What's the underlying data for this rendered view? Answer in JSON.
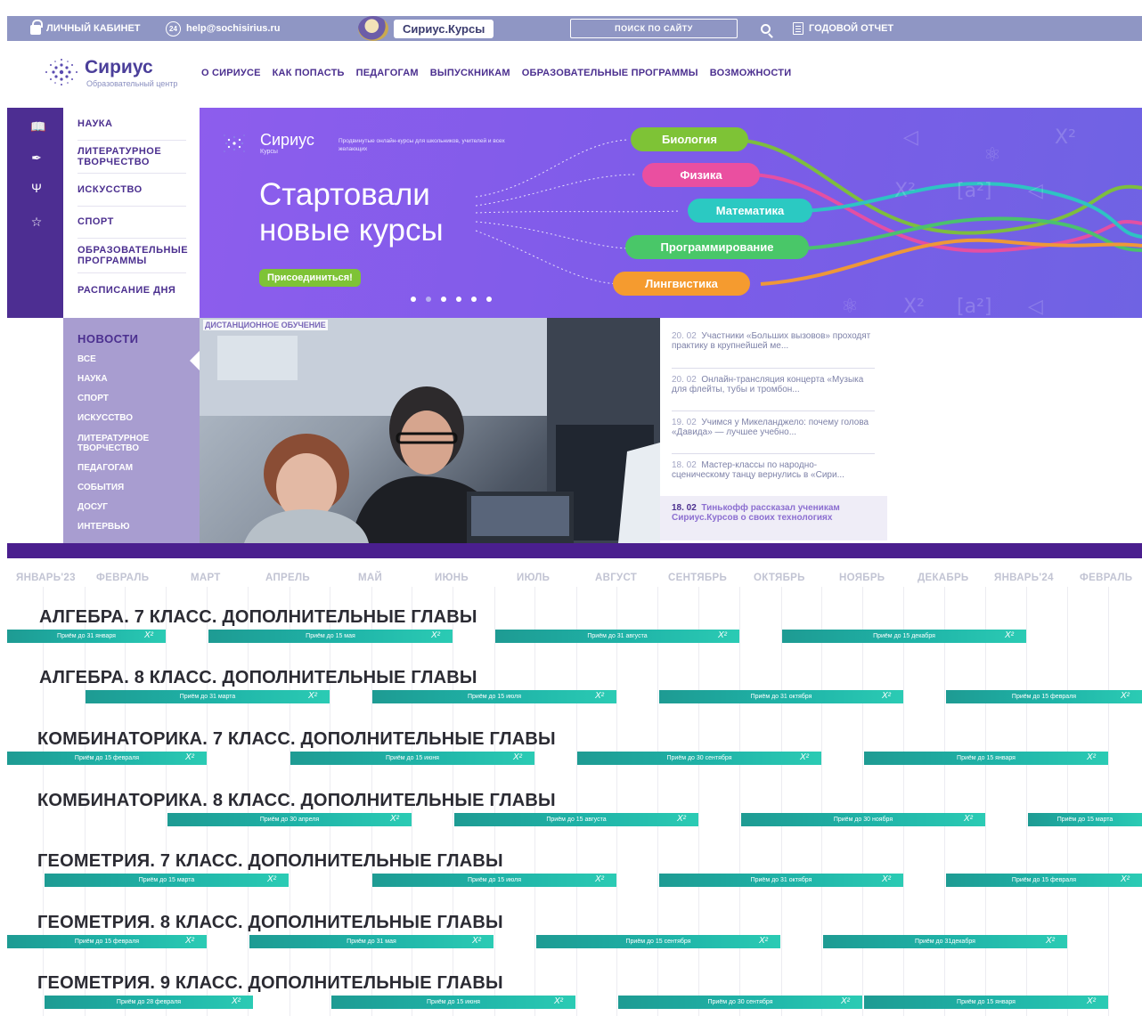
{
  "topbar": {
    "cabinet": "ЛИЧНЫЙ КАБИНЕТ",
    "email_icon_text": "24",
    "email": "help@sochisirius.ru",
    "kursy": "Сириус.Курсы",
    "search_placeholder": "ПОИСК ПО САЙТУ",
    "report": "ГОДОВОЙ ОТЧЕТ"
  },
  "header": {
    "logo_title": "Сириус",
    "logo_subtitle": "Образовательный центр",
    "nav": [
      "О СИРИУСЕ",
      "КАК ПОПАСТЬ",
      "ПЕДАГОГАМ",
      "ВЫПУСКНИКАМ",
      "ОБРАЗОВАТЕЛЬНЫЕ ПРОГРАММЫ",
      "ВОЗМОЖНОСТИ"
    ]
  },
  "leftmenu": {
    "items": [
      "НАУКА",
      "ЛИТЕРАТУРНОЕ ТВОРЧЕСТВО",
      "ИСКУССТВО",
      "СПОРТ",
      "ОБРАЗОВАТЕЛЬНЫЕ ПРОГРАММЫ",
      "РАСПИСАНИЕ ДНЯ"
    ],
    "icons": [
      "book-icon",
      "quill-icon",
      "lyre-icon",
      "trophy-icon"
    ]
  },
  "banner": {
    "logo_title": "Сириус",
    "logo_subtitle": "Курсы",
    "description": "Продвинутые онлайн-курсы для школьников, учителей и всех желающих",
    "headline": "Стартовали новые курсы",
    "join_button": "Присоединиться!",
    "subjects": [
      {
        "label": "Биология",
        "color": "#7ec336"
      },
      {
        "label": "Физика",
        "color": "#ea4fa0"
      },
      {
        "label": "Математика",
        "color": "#2bc9c2"
      },
      {
        "label": "Программирование",
        "color": "#49c768"
      },
      {
        "label": "Лингвистика",
        "color": "#f59b2f"
      }
    ],
    "slide_count": 6,
    "active_slide": 1
  },
  "news": {
    "heading": "НОВОСТИ",
    "categories": [
      "ВСЕ",
      "НАУКА",
      "СПОРТ",
      "ИСКУССТВО",
      "ЛИТЕРАТУРНОЕ ТВОРЧЕСТВО",
      "ПЕДАГОГАМ",
      "СОБЫТИЯ",
      "ДОСУГ",
      "ИНТЕРВЬЮ"
    ],
    "photo_tag": "ДИСТАНЦИОННОЕ ОБУЧЕНИЕ",
    "items": [
      {
        "date": "20. 02",
        "text": "Участники «Больших вызовов» проходят практику в крупнейшей ме..."
      },
      {
        "date": "20. 02",
        "text": "Онлайн-трансляция концерта «Музыка для флейты, тубы и тромбон..."
      },
      {
        "date": "19. 02",
        "text": "Учимся у Микеланджело: почему голова «Давида» — лучшее учебно..."
      },
      {
        "date": "18. 02",
        "text": "Мастер-классы по народно-сценическому танцу вернулись в «Сири..."
      },
      {
        "date": "18. 02",
        "text": "Тинькофф рассказал ученикам Сириус.Курсов о своих технологиях"
      }
    ]
  },
  "timeline": {
    "months": [
      "ЯНВАРЬ'23",
      "ФЕВРАЛЬ",
      "МАРТ",
      "АПРЕЛЬ",
      "МАЙ",
      "ИЮНЬ",
      "ИЮЛЬ",
      "АВГУСТ",
      "СЕНТЯБРЬ",
      "ОКТЯБРЬ",
      "НОЯБРЬ",
      "ДЕКАБРЬ",
      "ЯНВАРЬ'24",
      "ФЕВРАЛЬ"
    ],
    "bar_symbol": "X²",
    "courses": [
      {
        "title": "АЛГЕБРА. 7 КЛАСС. ДОПОЛНИТЕЛЬНЫЕ ГЛАВЫ",
        "bars": [
          "Приём до 31 января",
          "Приём до 15 мая",
          "Приём до 31 августа",
          "Приём до 15 декабря"
        ]
      },
      {
        "title": "АЛГЕБРА. 8 КЛАСС. ДОПОЛНИТЕЛЬНЫЕ ГЛАВЫ",
        "bars": [
          "Приём до 31 марта",
          "Приём до 15 июля",
          "Приём до 31 октября",
          "Приём до 15 февраля"
        ]
      },
      {
        "title": "КОМБИНАТОРИКА. 7 КЛАСС. ДОПОЛНИТЕЛЬНЫЕ ГЛАВЫ",
        "bars": [
          "Приём до 15 февраля",
          "Приём до 15 июня",
          "Приём до 30 сентября",
          "Приём до 15 января"
        ]
      },
      {
        "title": "КОМБИНАТОРИКА. 8 КЛАСС. ДОПОЛНИТЕЛЬНЫЕ ГЛАВЫ",
        "bars": [
          "Приём до 30 апреля",
          "Приём до 15 августа",
          "Приём до 30 ноября",
          "Приём до 15 марта"
        ]
      },
      {
        "title": "ГЕОМЕТРИЯ. 7 КЛАСС. ДОПОЛНИТЕЛЬНЫЕ ГЛАВЫ",
        "bars": [
          "Приём до 15 марта",
          "Приём до 15 июля",
          "Приём до 31 октября",
          "Приём до 15 февраля"
        ]
      },
      {
        "title": "ГЕОМЕТРИЯ. 8 КЛАСС. ДОПОЛНИТЕЛЬНЫЕ ГЛАВЫ",
        "bars": [
          "Приём до 15 февраля",
          "Приём до 31 мая",
          "Приём до 15 сентября",
          "Приём до 31декабря"
        ]
      },
      {
        "title": "ГЕОМЕТРИЯ. 9 КЛАСС. ДОПОЛНИТЕЛЬНЫЕ ГЛАВЫ",
        "bars": [
          "Приём до 28 февраля",
          "Приём до 15 июня",
          "Приём до 30 сентября",
          "Приём до 15 января"
        ]
      }
    ]
  }
}
